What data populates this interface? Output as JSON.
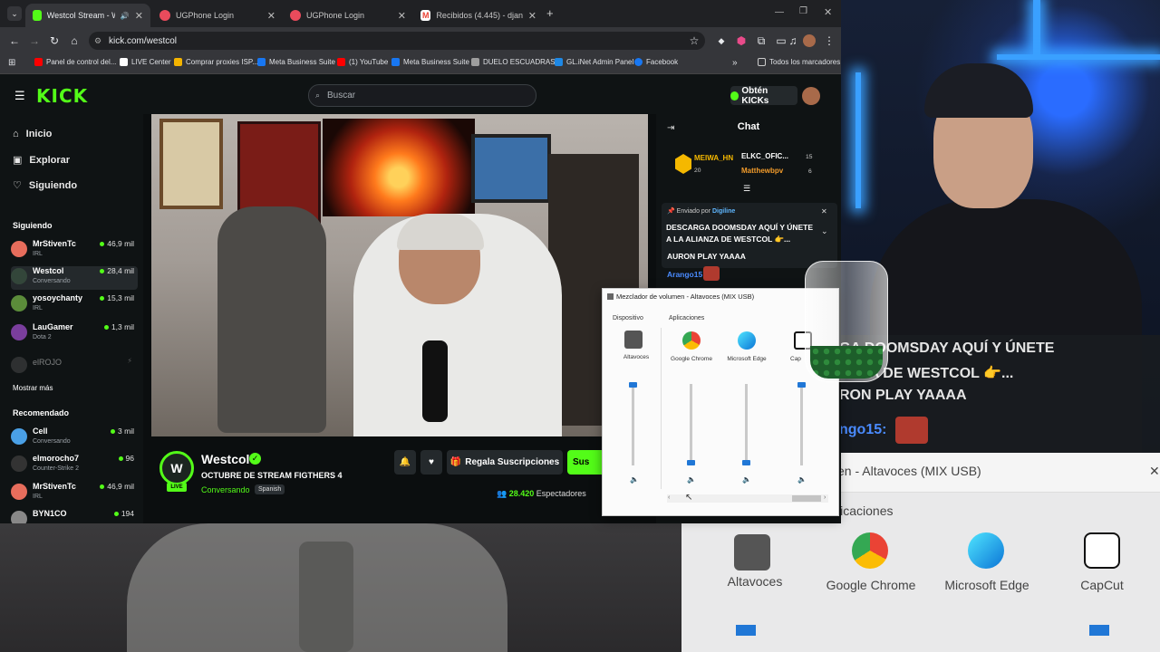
{
  "browser": {
    "tabs": [
      {
        "title": "Westcol Stream - Watch Liv",
        "favicon_color": "#53fc18",
        "active": true
      },
      {
        "title": "UGPhone Login",
        "favicon_color": "#e94b5c",
        "active": false
      },
      {
        "title": "UGPhone Login",
        "favicon_color": "#e94b5c",
        "active": false
      },
      {
        "title": "Recibidos (4.445) - djandro.ofic",
        "favicon_color": "#ea4335",
        "active": false
      }
    ],
    "new_tab": "+",
    "url": "kick.com/westcol",
    "bookmarks": [
      {
        "label": "Panel de control del...",
        "color": "#ff0000"
      },
      {
        "label": "LIVE Center",
        "color": "#ffffff"
      },
      {
        "label": "Comprar proxies ISP...",
        "color": "#f4b400"
      },
      {
        "label": "Meta Business Suite",
        "color": "#1877f2"
      },
      {
        "label": "(1) YouTube",
        "color": "#ff0000"
      },
      {
        "label": "Meta Business Suite",
        "color": "#1877f2"
      },
      {
        "label": "DUELO ESCUADRAS...",
        "color": "#9e9e9e"
      },
      {
        "label": "GL.iNet Admin Panel",
        "color": "#1e88e5"
      },
      {
        "label": "Facebook",
        "color": "#1877f2"
      }
    ],
    "bookmarks_more": "»",
    "all_bookmarks": "Todos los marcadores"
  },
  "kick": {
    "logo": "KICK",
    "search_placeholder": "Buscar",
    "get_kicks": "Obtén KICKs",
    "accent": "#53fc18",
    "nav": [
      {
        "label": "Inicio",
        "icon": "home-icon"
      },
      {
        "label": "Explorar",
        "icon": "compass-icon"
      },
      {
        "label": "Siguiendo",
        "icon": "heart-icon"
      }
    ],
    "following_title": "Siguiendo",
    "following": [
      {
        "name": "MrStivenTc",
        "sub": "IRL",
        "viewers": "46,9 mil",
        "color": "#e76d5c"
      },
      {
        "name": "Westcol",
        "sub": "Conversando",
        "viewers": "28,4 mil",
        "color": "#33463a"
      },
      {
        "name": "yosoychanty",
        "sub": "IRL",
        "viewers": "15,3 mil",
        "color": "#5b8c3a"
      },
      {
        "name": "LauGamer",
        "sub": "Dota 2",
        "viewers": "1,3 mil",
        "color": "#7a3e9d"
      },
      {
        "name": "elROJO",
        "sub": "",
        "viewers": "",
        "color": "#555555"
      }
    ],
    "show_more": "Mostrar más",
    "recommended_title": "Recomendado",
    "recommended": [
      {
        "name": "Cell",
        "sub": "Conversando",
        "viewers": "3 mil",
        "color": "#4aa0e6"
      },
      {
        "name": "elmorocho7",
        "sub": "Counter-Strike 2",
        "viewers": "96",
        "color": "#333333"
      },
      {
        "name": "MrStivenTc",
        "sub": "IRL",
        "viewers": "46,9 mil",
        "color": "#e76d5c"
      },
      {
        "name": "BYN1CO",
        "sub": "",
        "viewers": "194",
        "color": "#888888"
      }
    ],
    "stream": {
      "channel": "Westcol",
      "avatar_text": "W",
      "live": "LIVE",
      "title": "OCTUBRE  DE STREAM FIGTHERS 4",
      "category": "Conversando",
      "language": "Spanish",
      "gift_label": "Regala Suscripciones",
      "subscribe_label": "Sus",
      "viewers": "28.420",
      "viewers_label": "Espectadores"
    },
    "chat": {
      "title": "Chat",
      "gifters": [
        {
          "name": "MEIWA_HN",
          "count": "20"
        },
        {
          "name": "ELKC_OFIC...",
          "count": "15"
        },
        {
          "name": "Matthewbpv",
          "count": "6"
        }
      ],
      "pinned_by_label": "Enviado por",
      "pinned_by_user": "Digiline",
      "pinned_message": "DESCARGA DOOMSDAY AQUÍ Y ÚNETE A LA ALIANZA DE WESTCOL 👉...",
      "messages": [
        {
          "user": "",
          "text": "AURON PLAY YAAAA"
        },
        {
          "user": "Arango15:",
          "text": ""
        }
      ]
    }
  },
  "mixer": {
    "title": "Mezclador de volumen - Altavoces (MIX USB)",
    "device_label": "Dispositivo",
    "apps_label": "Aplicaciones",
    "channels": [
      {
        "label": "Altavoces",
        "icon": "speaker-device-icon",
        "level": 1.0,
        "color": "#555555"
      },
      {
        "label": "Google Chrome",
        "icon": "chrome-icon",
        "level": 0.0,
        "color": "#4285f4"
      },
      {
        "label": "Microsoft Edge",
        "icon": "edge-icon",
        "level": 0.0,
        "color": "#0b74d6"
      },
      {
        "label": "CapCut",
        "icon": "capcut-icon",
        "level": 1.0,
        "color": "#111111"
      }
    ],
    "slider_color": "#2077d6"
  },
  "overlay": {
    "chat_lines": [
      "GA DOOMSDAY AQUÍ Y ÚNETE",
      "ANZA DE WESTCOL 👉...",
      "RON PLAY YAAAA",
      "ngo15:"
    ],
    "big_mixer_title": "en - Altavoces (MIX USB)",
    "big_close": "✕",
    "big_apps_label": "licaciones",
    "big_labels": [
      "Altavoces",
      "Google Chrome",
      "Microsoft Edge",
      "CapCut"
    ]
  }
}
